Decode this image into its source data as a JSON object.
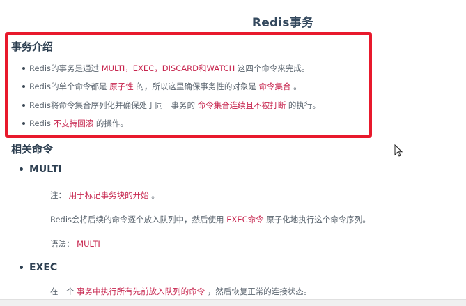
{
  "title": "Redis事务",
  "intro": {
    "heading": "事务介绍",
    "items": [
      {
        "a": "Redis的事务是通过 ",
        "b": "MULTI，EXEC，DISCARD和WATCH",
        "c": " 这四个命令来完成。"
      },
      {
        "a": "Redis的单个命令都是 ",
        "b": "原子性",
        "c": " 的，所以这里确保事务性的对象是 ",
        "d": "命令集合",
        "e": " 。"
      },
      {
        "a": "Redis将命令集合序列化并确保处于同一事务的 ",
        "b": "命令集合连续且不被打断",
        "c": " 的执行。"
      },
      {
        "a": "Redis ",
        "b": "不支持回滚",
        "c": " 的操作。"
      }
    ]
  },
  "commands": {
    "heading": "相关命令",
    "multi": {
      "name": "MULTI",
      "note_label": "注：",
      "note_hl": "用于标记事务块的开始",
      "note_end": " 。",
      "desc_a": "Redis会将后续的命令逐个放入队列中，然后使用 ",
      "desc_hl": "EXEC命令",
      "desc_c": " 原子化地执行这个命令序列。",
      "syntax_label": "语法：",
      "syntax_val": "MULTI"
    },
    "exec": {
      "name": "EXEC",
      "desc_a": "在一个 ",
      "desc_hl": "事务中执行所有先前放入队列的命令",
      "desc_c": " ，然后恢复正常的连接状态。"
    }
  },
  "colors": {
    "highlight": "#c7254e",
    "box_border": "#e8192c",
    "heading": "#2c3e50"
  },
  "icons": {
    "cursor": "mouse-pointer-icon"
  }
}
